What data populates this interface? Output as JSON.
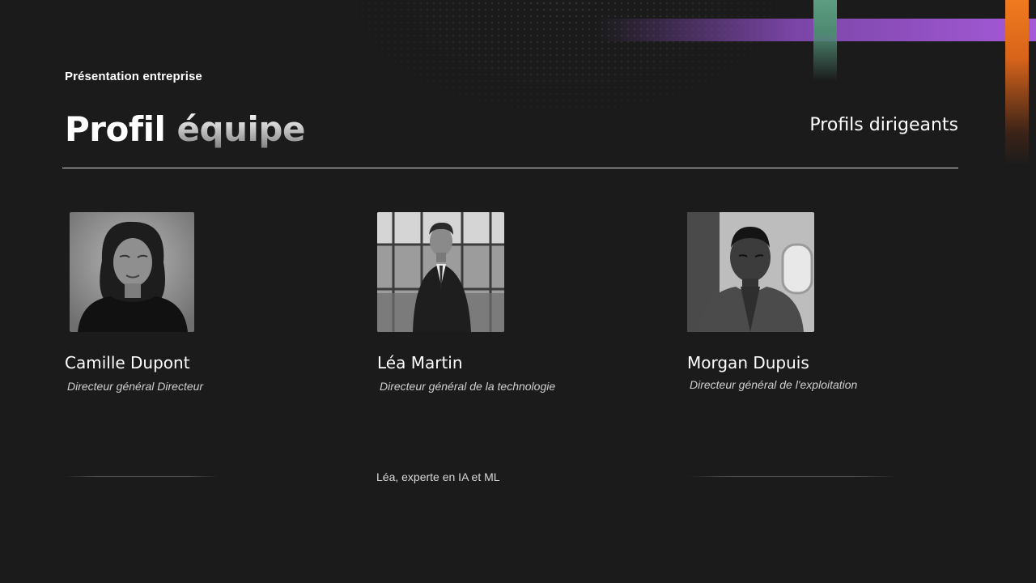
{
  "header": {
    "eyebrow": "Présentation entreprise",
    "title_part1": "Profil",
    "title_part2": "équipe",
    "subtitle": "Profils dirigeants"
  },
  "team": [
    {
      "name": "Camille Dupont",
      "role": "Directeur général Directeur",
      "photo": "portrait-woman-icon"
    },
    {
      "name": "Léa Martin",
      "role": "Directeur général de la technologie",
      "photo": "portrait-man-suit-icon",
      "bio": "Léa, experte en IA et ML"
    },
    {
      "name": "Morgan Dupuis",
      "role": "Directeur général de l'exploitation",
      "photo": "portrait-man-airplane-icon"
    }
  ],
  "colors": {
    "background": "#1b1b1c",
    "accent_purple": "#a55ad8",
    "accent_green": "#5e9d82",
    "accent_orange": "#f07a1e"
  }
}
